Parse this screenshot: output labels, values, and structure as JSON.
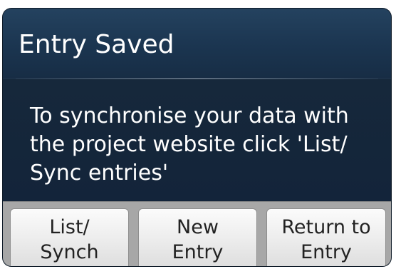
{
  "dialog": {
    "title": "Entry Saved",
    "message": "To synchronise your data with the project website click 'List/ Sync entries'"
  },
  "buttons": {
    "list_sync": "List/\nSynch",
    "new_entry": "New\nEntry",
    "return_to_entry": "Return to\nEntry"
  },
  "colors": {
    "dialog_background": "#1c3148",
    "header_background": "#24425f",
    "text": "#ffffff",
    "button_bar": "#a7a7a7",
    "button_face": "#eeeeee",
    "button_text": "#222222"
  }
}
